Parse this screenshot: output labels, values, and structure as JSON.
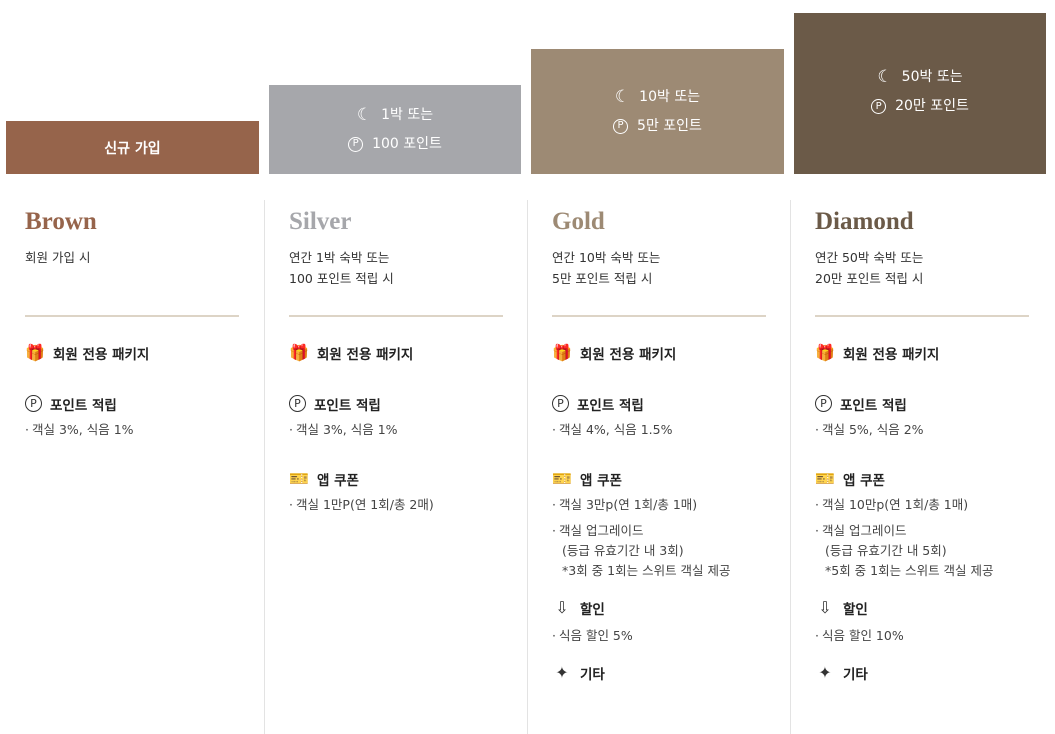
{
  "colors": {
    "brown": "#96644b",
    "silver": "#a6a7ab",
    "gold": "#9d8a74",
    "diamond": "#6b5a48",
    "divider": "#ddd4c6"
  },
  "bars": {
    "brown": {
      "label": "신규 가입"
    },
    "silver": {
      "line1": "1박 또는",
      "line2": "100 포인트"
    },
    "gold": {
      "line1": "10박 또는",
      "line2": "5만 포인트"
    },
    "diamond": {
      "line1": "50박 또는",
      "line2": "20만 포인트"
    }
  },
  "icons": {
    "moon": "☾",
    "point": "P",
    "gift": "🎁",
    "coupon": "🎫",
    "discount": "⇩",
    "other": "✦"
  },
  "tiers": {
    "brown": {
      "name": "Brown",
      "cond1": "회원 가입 시",
      "package": "회원 전용 패키지",
      "points_title": "포인트 적립",
      "points_item": "객실 3%, 식음 1%"
    },
    "silver": {
      "name": "Silver",
      "cond1": "연간 1박 숙박 또는",
      "cond2": "100 포인트 적립 시",
      "package": "회원 전용 패키지",
      "points_title": "포인트 적립",
      "points_item": "객실 3%, 식음 1%",
      "coupon_title": "앱 쿠폰",
      "coupon_item": "객실 1만P(연 1회/총 2매)"
    },
    "gold": {
      "name": "Gold",
      "cond1": "연간 10박 숙박 또는",
      "cond2": "5만 포인트 적립 시",
      "package": "회원 전용 패키지",
      "points_title": "포인트 적립",
      "points_item": "객실 4%, 식음 1.5%",
      "coupon_title": "앱 쿠폰",
      "coupon_item1": "객실 3만p(연 1회/총 1매)",
      "coupon_item2_l1": "객실 업그레이드",
      "coupon_item2_l2": "(등급 유효기간 내 3회)",
      "coupon_item2_l3": "*3회 중 1회는 스위트 객실 제공",
      "discount_title": "할인",
      "discount_item": "식음 할인 5%",
      "other_title": "기타"
    },
    "diamond": {
      "name": "Diamond",
      "cond1": "연간 50박 숙박 또는",
      "cond2": "20만 포인트 적립 시",
      "package": "회원 전용 패키지",
      "points_title": "포인트 적립",
      "points_item": "객실 5%, 식음 2%",
      "coupon_title": "앱 쿠폰",
      "coupon_item1": "객실 10만p(연 1회/총 1매)",
      "coupon_item2_l1": "객실 업그레이드",
      "coupon_item2_l2": "(등급 유효기간 내 5회)",
      "coupon_item2_l3": "*5회 중 1회는 스위트 객실 제공",
      "discount_title": "할인",
      "discount_item": "식음 할인 10%",
      "other_title": "기타"
    }
  }
}
